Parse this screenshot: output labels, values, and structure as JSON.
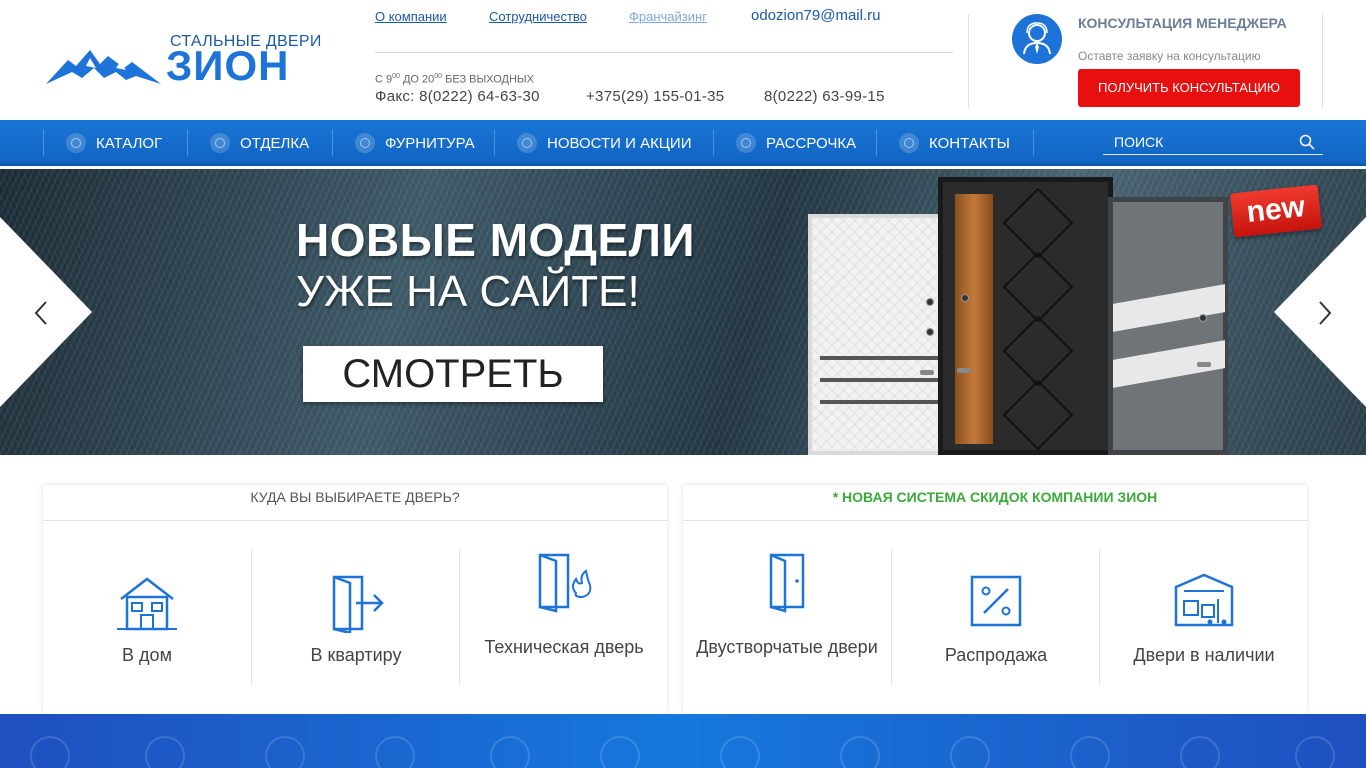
{
  "header": {
    "logo_top": "СТАЛЬНЫЕ ДВЕРИ",
    "logo_main": "ЗИОН",
    "links": {
      "about": "О компании",
      "cooperation": "Сотрудничество",
      "franchise": "Франчайзинг"
    },
    "email": "odozion79@mail.ru",
    "hours_prefix": "С 9",
    "hours_sup1": "00",
    "hours_mid": " ДО 20",
    "hours_sup2": "00",
    "hours_suffix": " БЕЗ ВЫХОДНЫХ",
    "phones": [
      "Факс: 8(0222) 64-63-30",
      "+375(29) 155-01-35",
      "8(0222) 63-99-15"
    ],
    "consult_title": "КОНСУЛЬТАЦИЯ МЕНЕДЖЕРА",
    "consult_sub": "Оставте заявку на консультацию",
    "consult_button": "ПОЛУЧИТЬ КОНСУЛЬТАЦИЮ"
  },
  "nav": {
    "items": [
      {
        "label": "КАТАЛОГ"
      },
      {
        "label": "ОТДЕЛКА"
      },
      {
        "label": "ФУРНИТУРА"
      },
      {
        "label": "НОВОСТИ И АКЦИИ"
      },
      {
        "label": "РАССРОЧКА"
      },
      {
        "label": "КОНТАКТЫ"
      }
    ],
    "search_placeholder": "ПОИСК"
  },
  "hero": {
    "title": "НОВЫЕ МОДЕЛИ",
    "subtitle": "УЖЕ НА САЙТЕ!",
    "cta": "СМОТРЕТЬ",
    "badge": "new"
  },
  "cards": {
    "left": {
      "title": "КУДА ВЫ ВЫБИРАЕТЕ ДВЕРЬ?",
      "tiles": [
        {
          "label": "В дом",
          "icon": "house-icon"
        },
        {
          "label": "В квартиру",
          "icon": "door-exit-icon"
        },
        {
          "label": "Техническая дверь",
          "icon": "fire-door-icon"
        }
      ]
    },
    "right": {
      "title": "* НОВАЯ СИСТЕМА СКИДОК КОМПАНИИ ЗИОН",
      "tiles": [
        {
          "label": "Двустворчатые двери",
          "icon": "double-door-icon"
        },
        {
          "label": "Распродажа",
          "icon": "percent-icon"
        },
        {
          "label": "Двери в наличии",
          "icon": "warehouse-icon"
        }
      ]
    }
  },
  "colors": {
    "brand_blue": "#1e73d8",
    "nav_blue": "#1a75d6",
    "cta_red": "#e80f0f",
    "green_title": "#3aaa3a"
  }
}
